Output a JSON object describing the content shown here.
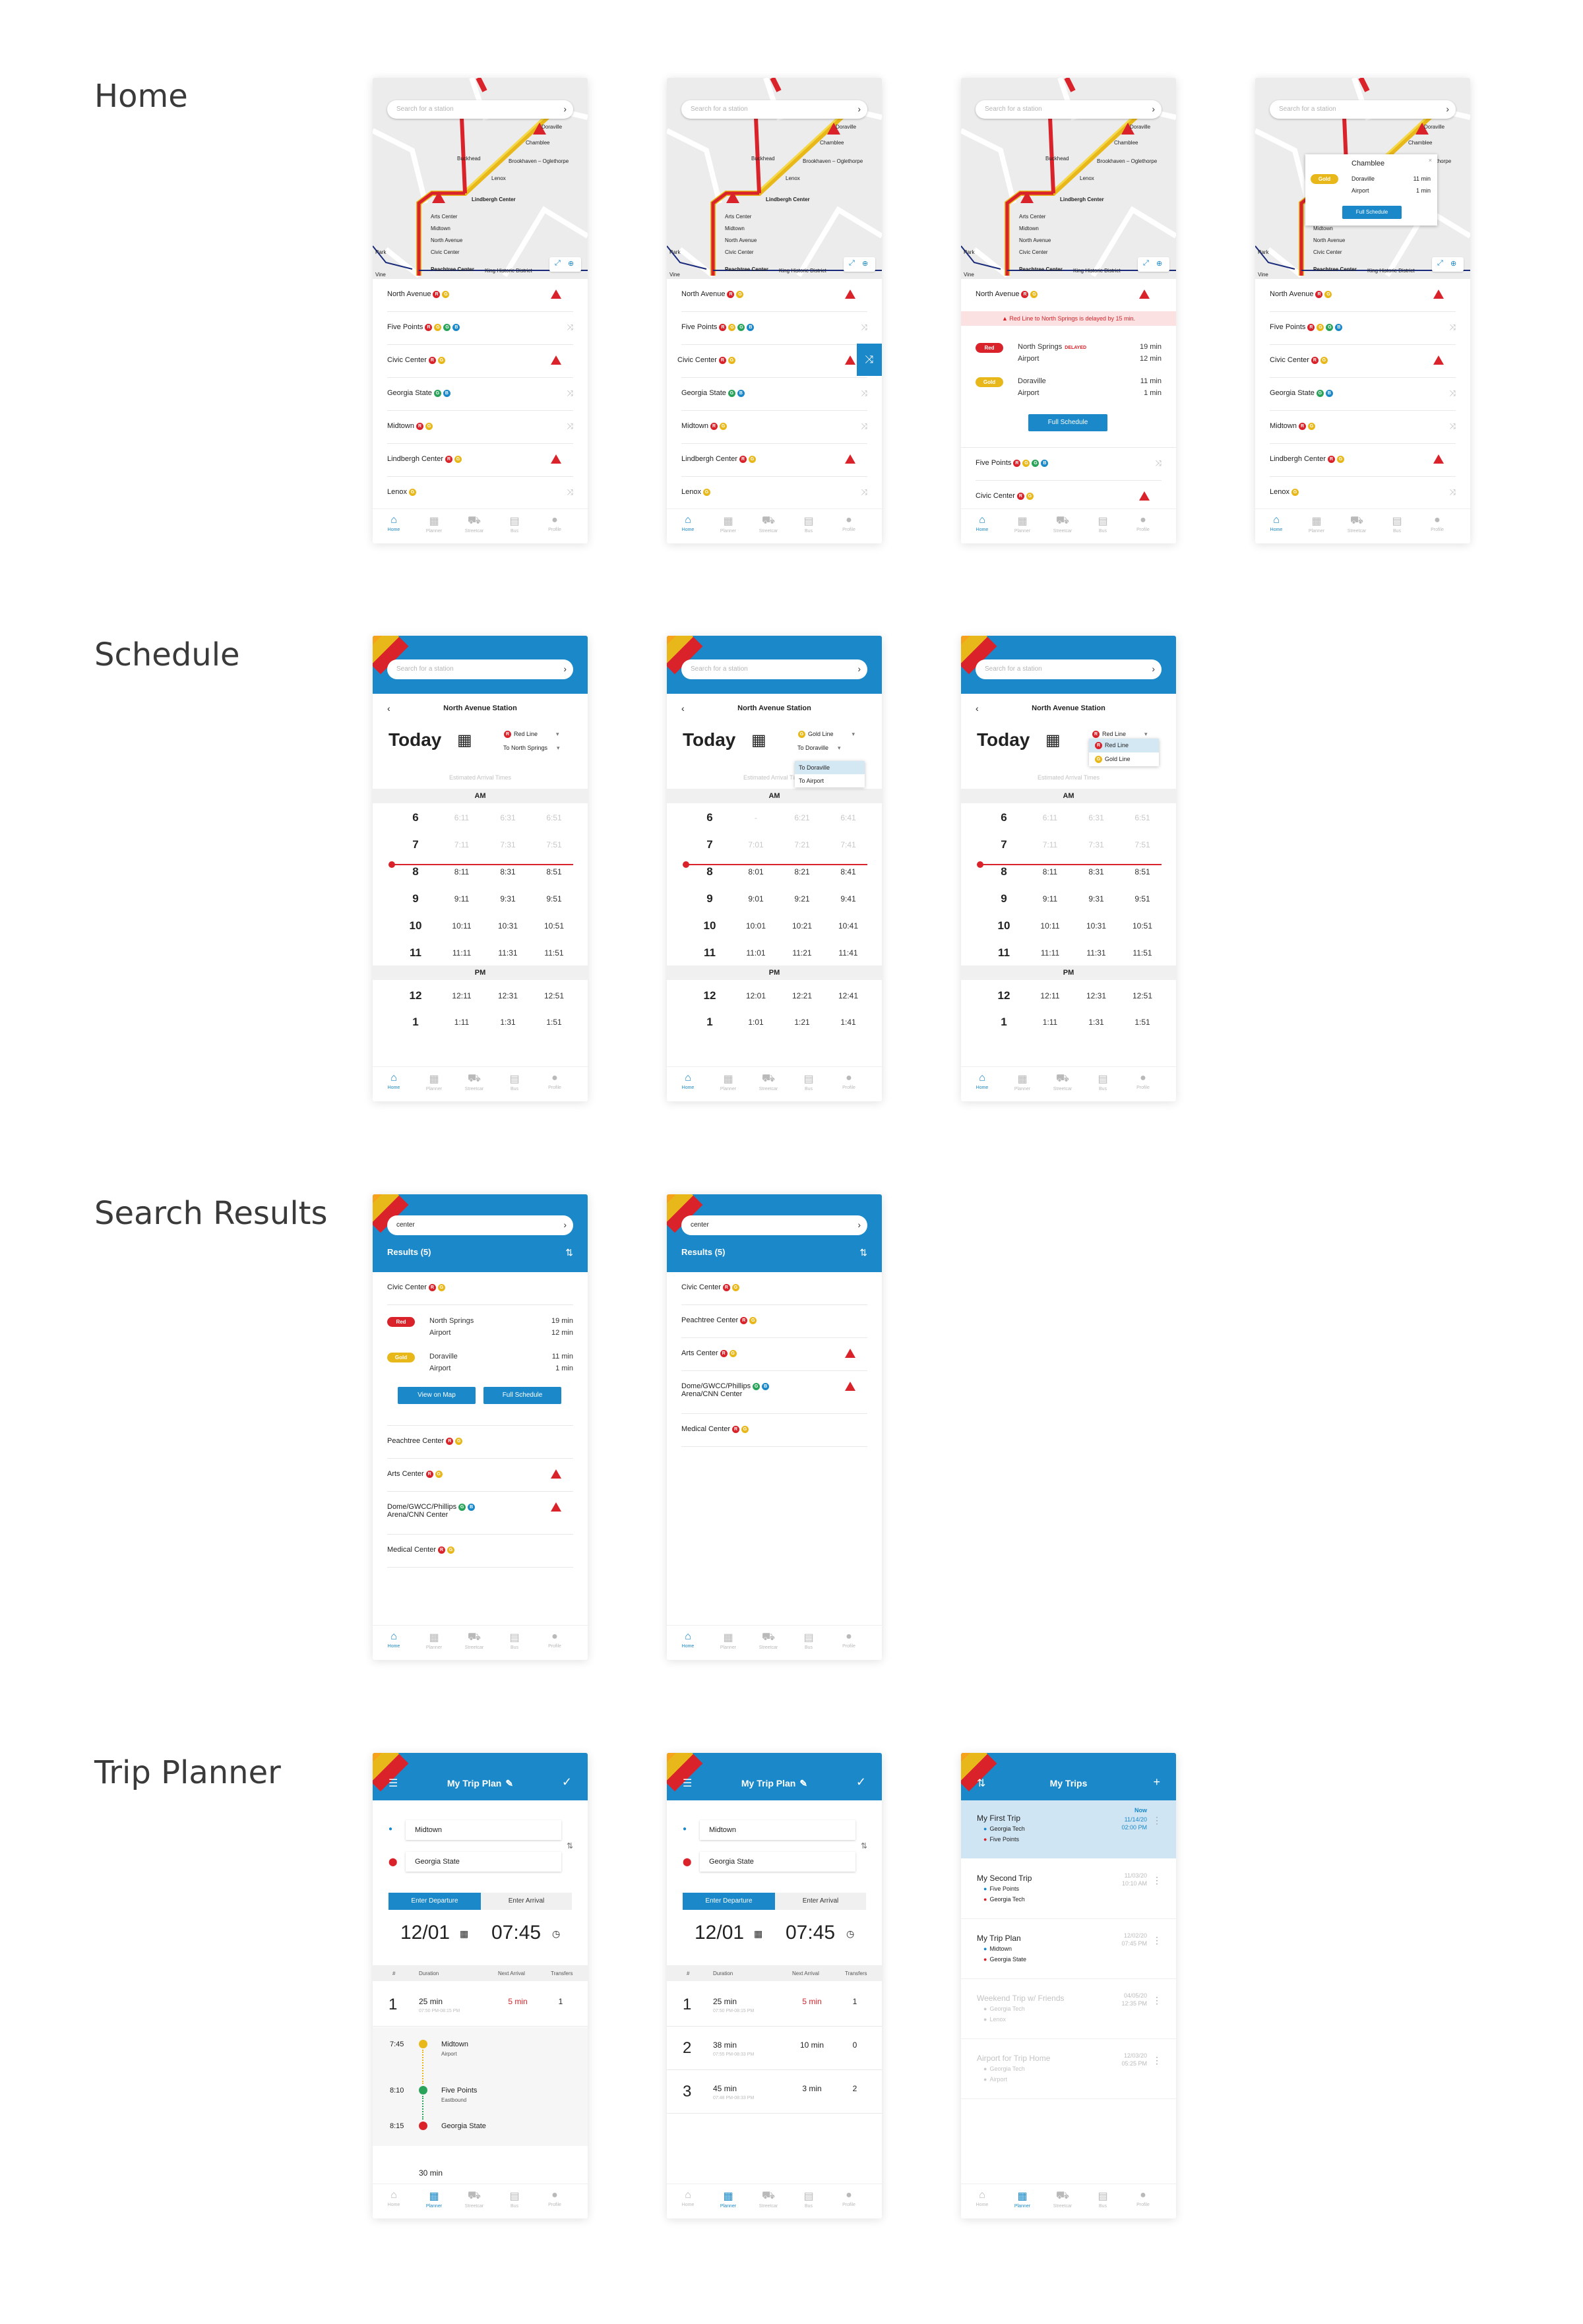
{
  "sections": {
    "home": "Home",
    "schedule": "Schedule",
    "search_results": "Search Results",
    "trip_planner": "Trip Planner"
  },
  "search_placeholder": "Search for a station",
  "tabs": [
    "Home",
    "Planner",
    "Streetcar",
    "Bus",
    "Profile"
  ],
  "map_labels": {
    "doraville": "Doraville",
    "chamblee": "Chamblee",
    "brookhaven": "Brookhaven – Oglethorpe",
    "buckhead": "Buckhead",
    "lenox": "Lenox",
    "lindbergh": "Lindbergh Center",
    "arts": "Arts Center",
    "midtown": "Midtown",
    "north_avenue": "North Avenue",
    "civic": "Civic Center",
    "peachtree": "Peachtree Center",
    "king": "King Historic District",
    "park": "Park",
    "vine": "Vine"
  },
  "stations": [
    {
      "name": "North Avenue",
      "lines": [
        "R",
        "G"
      ],
      "alert": true
    },
    {
      "name": "Five Points",
      "lines": [
        "R",
        "G",
        "N",
        "B"
      ],
      "alert": false
    },
    {
      "name": "Civic Center",
      "lines": [
        "R",
        "G"
      ],
      "alert": true
    },
    {
      "name": "Georgia State",
      "lines": [
        "N",
        "B"
      ],
      "alert": false
    },
    {
      "name": "Midtown",
      "lines": [
        "R",
        "G"
      ],
      "alert": false
    },
    {
      "name": "Lindbergh Center",
      "lines": [
        "R",
        "G"
      ],
      "alert": true
    },
    {
      "name": "Lenox",
      "lines": [
        "G"
      ],
      "alert": false
    }
  ],
  "detail": {
    "alert": "Red Line to North Springs is delayed by 15 min.",
    "red_label": "Red",
    "gold_label": "Gold",
    "red_dest_1": "North Springs",
    "delayed": "DELAYED",
    "red_dest_2": "Airport",
    "red_min_1": "19 min",
    "red_min_2": "12 min",
    "gold_dest_1": "Doraville",
    "gold_dest_2": "Airport",
    "gold_min_1": "11 min",
    "gold_min_2": "1 min",
    "full_schedule": "Full Schedule"
  },
  "popup": {
    "station": "Chamblee",
    "gold_label": "Gold",
    "dest_1": "Doraville",
    "dest_2": "Airport",
    "min_1": "11 min",
    "min_2": "1 min",
    "button": "Full Schedule"
  },
  "schedule": {
    "station": "North Avenue Station",
    "today": "Today",
    "estimated": "Estimated Arrival Times",
    "am": "AM",
    "pm": "PM",
    "red_line": "Red Line",
    "gold_line": "Gold Line",
    "to_north_springs": "To North Springs",
    "to_doraville": "To Doraville",
    "to_airport": "To Airport",
    "hours_am": [
      "6",
      "7",
      "8",
      "9",
      "10",
      "11"
    ],
    "times_red": [
      [
        "6:11",
        "6:31",
        "6:51"
      ],
      [
        "7:11",
        "7:31",
        "7:51"
      ],
      [
        "8:11",
        "8:31",
        "8:51"
      ],
      [
        "9:11",
        "9:31",
        "9:51"
      ],
      [
        "10:11",
        "10:31",
        "10:51"
      ],
      [
        "11:11",
        "11:31",
        "11:51"
      ]
    ],
    "times_gold": [
      [
        "-",
        "6:21",
        "6:41"
      ],
      [
        "7:01",
        "7:21",
        "7:41"
      ],
      [
        "8:01",
        "8:21",
        "8:41"
      ],
      [
        "9:01",
        "9:21",
        "9:41"
      ],
      [
        "10:01",
        "10:21",
        "10:41"
      ],
      [
        "11:01",
        "11:21",
        "11:41"
      ]
    ],
    "pm_row_red": [
      "12",
      "12:11",
      "12:31",
      "12:51"
    ],
    "pm_row_gold": [
      "12",
      "12:01",
      "12:21",
      "12:41"
    ],
    "pm_row2_red": [
      "1",
      "1:11",
      "1:31",
      "1:51"
    ],
    "pm_row2_gold": [
      "1",
      "1:01",
      "1:21",
      "1:41"
    ]
  },
  "search": {
    "query": "center",
    "results_label": "Results (5)",
    "view_on_map": "View on Map",
    "full_schedule": "Full Schedule",
    "results": [
      {
        "name": "Civic Center",
        "lines": [
          "R",
          "G"
        ],
        "alert": false
      },
      {
        "name": "Peachtree Center",
        "lines": [
          "R",
          "G"
        ],
        "alert": false
      },
      {
        "name": "Arts Center",
        "lines": [
          "R",
          "G"
        ],
        "alert": true
      },
      {
        "name": "Dome/GWCC/Phillips",
        "name2": "Arena/CNN Center",
        "lines": [
          "N",
          "B"
        ],
        "alert": true
      },
      {
        "name": "Medical Center",
        "lines": [
          "R",
          "G"
        ],
        "alert": false
      }
    ]
  },
  "trip": {
    "title": "My Trip Plan",
    "origin": "Midtown",
    "destination": "Georgia State",
    "enter_departure": "Enter Departure",
    "enter_arrival": "Enter Arrival",
    "date": "12/01",
    "time": "07:45",
    "col_num": "#",
    "col_duration": "Duration",
    "col_next": "Next Arrival",
    "col_transfers": "Transfers",
    "options": [
      {
        "n": "1",
        "dur": "25 min",
        "sub": "07:50 PM-08:15 PM",
        "next": "5 min",
        "transfers": "1"
      },
      {
        "n": "2",
        "dur": "38 min",
        "sub": "07:55 PM-08:33 PM",
        "next": "10 min",
        "transfers": "0"
      },
      {
        "n": "3",
        "dur": "45 min",
        "sub": "07:48 PM-08:33 PM",
        "next": "3 min",
        "transfers": "2"
      }
    ],
    "legs": [
      {
        "time": "7:45",
        "stop": "Midtown",
        "sub": "Airport"
      },
      {
        "time": "8:10",
        "stop": "Five Points",
        "sub": "Eastbound"
      },
      {
        "time": "8:15",
        "stop": "Georgia State",
        "sub": ""
      }
    ],
    "next_dur": "30 min"
  },
  "my_trips": {
    "title": "My Trips",
    "items": [
      {
        "name": "My First Trip",
        "a": "Georgia Tech",
        "b": "Five Points",
        "r1": "Now",
        "r2": "11/14/20",
        "r3": "02:00 PM",
        "faded": false
      },
      {
        "name": "My Second Trip",
        "a": "Five Points",
        "b": "Georgia Tech",
        "r1": "",
        "r2": "11/03/20",
        "r3": "10:10 AM",
        "faded": false
      },
      {
        "name": "My Trip Plan",
        "a": "Midtown",
        "b": "Georgia State",
        "r1": "",
        "r2": "12/02/20",
        "r3": "07:45 PM",
        "faded": false
      },
      {
        "name": "Weekend Trip w/ Friends",
        "a": "Georgia Tech",
        "b": "Lenox",
        "r1": "",
        "r2": "04/05/20",
        "r3": "12:35 PM",
        "faded": true
      },
      {
        "name": "Airport for Trip Home",
        "a": "Georgia Tech",
        "b": "Airport",
        "r1": "",
        "r2": "12/03/20",
        "r3": "05:25 PM",
        "faded": true
      }
    ]
  }
}
